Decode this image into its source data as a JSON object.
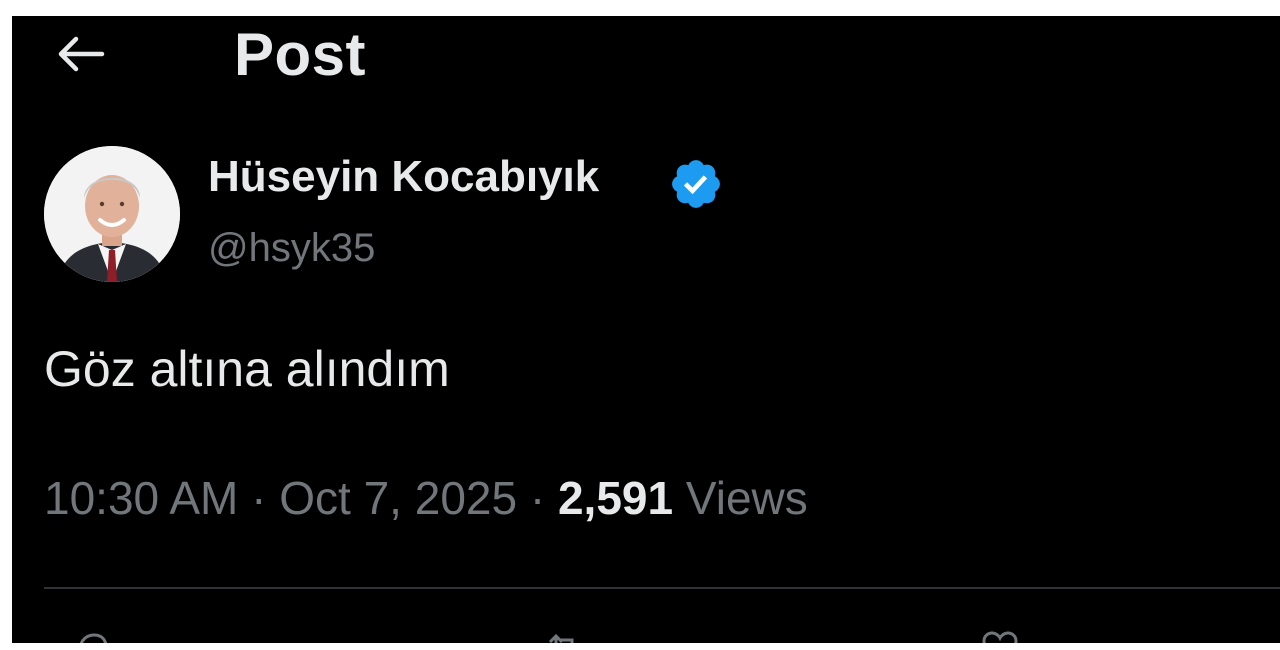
{
  "header": {
    "title": "Post",
    "back_icon": "arrow-left-icon"
  },
  "author": {
    "display_name": "Hüseyin Kocabıyık",
    "handle": "@hsyk35",
    "verified": true,
    "verified_icon": "verified-badge-icon",
    "verified_color": "#1d9bf0"
  },
  "post": {
    "text": "Göz altına alındım",
    "time": "10:30 AM",
    "separator": " · ",
    "date": "Oct 7, 2025",
    "views_count": "2,591",
    "views_label": " Views"
  },
  "colors": {
    "background": "#000000",
    "primary_text": "#e7e9ea",
    "secondary_text": "#71767b",
    "divider": "#2f3336"
  }
}
